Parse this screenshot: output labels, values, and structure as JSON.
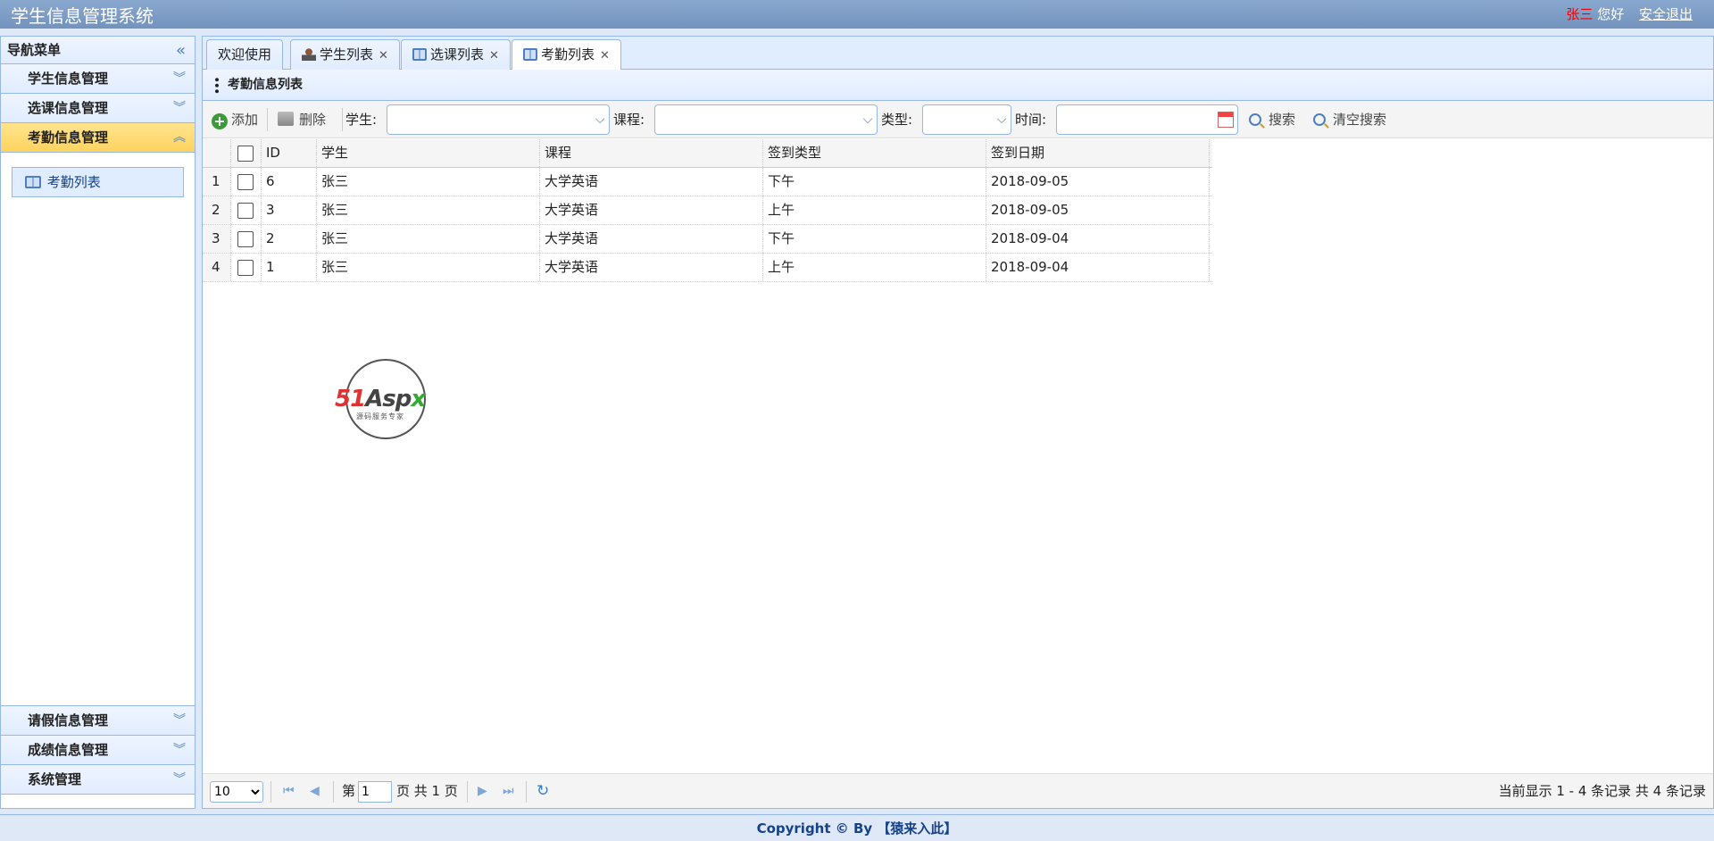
{
  "header": {
    "title": "学生信息管理系统",
    "user_name": "张三",
    "greeting": "您好",
    "logout": "安全退出"
  },
  "sidebar": {
    "title": "导航菜单",
    "groups": [
      {
        "label": "学生信息管理"
      },
      {
        "label": "选课信息管理"
      },
      {
        "label": "考勤信息管理"
      },
      {
        "label": "请假信息管理"
      },
      {
        "label": "成绩信息管理"
      },
      {
        "label": "系统管理"
      }
    ],
    "active_link": "考勤列表"
  },
  "tabs": [
    {
      "label": "欢迎使用"
    },
    {
      "label": "学生列表"
    },
    {
      "label": "选课列表"
    },
    {
      "label": "考勤列表"
    }
  ],
  "panel": {
    "title": "考勤信息列表"
  },
  "toolbar": {
    "add": "添加",
    "delete": "删除",
    "student_label": "学生:",
    "course_label": "课程:",
    "type_label": "类型:",
    "time_label": "时间:",
    "search": "搜索",
    "clear_search": "清空搜索"
  },
  "table": {
    "headers": [
      "ID",
      "学生",
      "课程",
      "签到类型",
      "签到日期"
    ],
    "rows": [
      {
        "n": "1",
        "id": "6",
        "student": "张三",
        "course": "大学英语",
        "type": "下午",
        "date": "2018-09-05"
      },
      {
        "n": "2",
        "id": "3",
        "student": "张三",
        "course": "大学英语",
        "type": "上午",
        "date": "2018-09-05"
      },
      {
        "n": "3",
        "id": "2",
        "student": "张三",
        "course": "大学英语",
        "type": "下午",
        "date": "2018-09-04"
      },
      {
        "n": "4",
        "id": "1",
        "student": "张三",
        "course": "大学英语",
        "type": "上午",
        "date": "2018-09-04"
      }
    ]
  },
  "watermark": {
    "brand_red": "51",
    "brand_gray": "Asp",
    "brand_green": "x",
    "tagline": "源码服务专家"
  },
  "pager": {
    "page_size": "10",
    "page_prefix": "第",
    "page_value": "1",
    "page_suffix": "页 共 1 页",
    "summary": "当前显示 1 - 4 条记录 共 4 条记录"
  },
  "footer": {
    "text": "Copyright © By 【猿来入此】"
  }
}
